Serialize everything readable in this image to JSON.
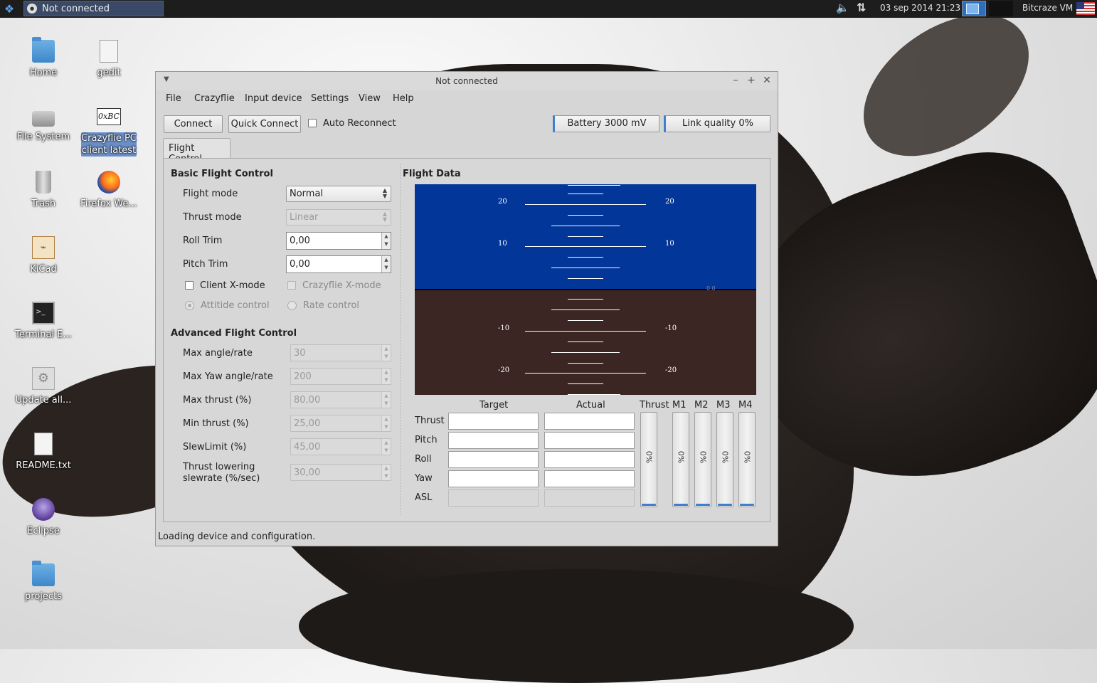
{
  "panel": {
    "task_title": "Not connected",
    "clock": "03 sep 2014 21:23",
    "user": "Bitcraze VM",
    "icons": {
      "menu": "xfce-menu-icon",
      "volume": "volume-icon",
      "network": "network-icon"
    }
  },
  "desktop": [
    {
      "label": "Home",
      "icon": "home-folder-icon"
    },
    {
      "label": "gedit",
      "icon": "text-editor-icon"
    },
    {
      "label": "File System",
      "icon": "hard-drive-icon"
    },
    {
      "label": "Crazyflie PC client latest",
      "icon": "bitcraze-icon"
    },
    {
      "label": "Trash",
      "icon": "trash-icon"
    },
    {
      "label": "Firefox We...",
      "icon": "firefox-icon"
    },
    {
      "label": "KiCad",
      "icon": "kicad-icon"
    },
    {
      "label": "Terminal E...",
      "icon": "terminal-icon"
    },
    {
      "label": "Update all...",
      "icon": "gear-icon"
    },
    {
      "label": "README.txt",
      "icon": "text-file-icon"
    },
    {
      "label": "Eclipse",
      "icon": "eclipse-icon"
    },
    {
      "label": "projects",
      "icon": "folder-icon"
    }
  ],
  "window": {
    "title": "Not connected",
    "menu": [
      "File",
      "Crazyflie",
      "Input device",
      "Settings",
      "View",
      "Help"
    ],
    "toolbar": {
      "connect": "Connect",
      "quick_connect": "Quick Connect",
      "auto_reconnect": "Auto Reconnect",
      "battery": "Battery 3000 mV",
      "link_quality": "Link quality 0%"
    },
    "tab": "Flight Control",
    "basic": {
      "title": "Basic Flight Control",
      "flight_mode_label": "Flight mode",
      "flight_mode_value": "Normal",
      "thrust_mode_label": "Thrust mode",
      "thrust_mode_value": "Linear",
      "roll_trim_label": "Roll Trim",
      "roll_trim_value": "0,00",
      "pitch_trim_label": "Pitch Trim",
      "pitch_trim_value": "0,00",
      "client_xmode": "Client X-mode",
      "crazyflie_xmode": "Crazyflie X-mode",
      "attitude_control": "Attitide control",
      "rate_control": "Rate control"
    },
    "advanced": {
      "title": "Advanced Flight Control",
      "rows": [
        {
          "label": "Max angle/rate",
          "value": "30"
        },
        {
          "label": "Max Yaw angle/rate",
          "value": "200"
        },
        {
          "label": "Max thrust (%)",
          "value": "80,00"
        },
        {
          "label": "Min thrust (%)",
          "value": "25,00"
        },
        {
          "label": "SlewLimit (%)",
          "value": "45,00"
        },
        {
          "label": "Thrust lowering slewrate (%/sec)",
          "value": "30,00"
        }
      ]
    },
    "flight_data": {
      "title": "Flight Data",
      "horizon_labels": {
        "p20": "20",
        "p10": "10",
        "n10": "-10",
        "n20": "-20",
        "alt": "0.0"
      },
      "col_target": "Target",
      "col_actual": "Actual",
      "rows": [
        "Thrust",
        "Pitch",
        "Roll",
        "Yaw",
        "ASL"
      ],
      "bars": [
        {
          "label": "Thrust",
          "value": "0%",
          "level": 0
        },
        {
          "label": "M1",
          "value": "0%",
          "level": 0
        },
        {
          "label": "M2",
          "value": "0%",
          "level": 0
        },
        {
          "label": "M3",
          "value": "0%",
          "level": 0
        },
        {
          "label": "M4",
          "value": "0%",
          "level": 0
        }
      ]
    },
    "status": "Loading device and configuration."
  }
}
